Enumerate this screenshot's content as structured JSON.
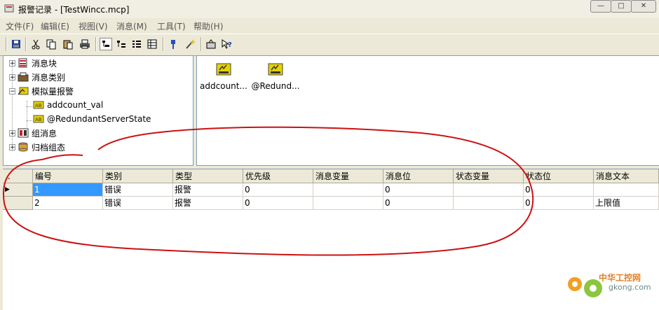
{
  "window": {
    "title": "报警记录 - [TestWincc.mcp]"
  },
  "window_buttons": {
    "minimize": "—",
    "maximize": "□",
    "close": "✕"
  },
  "menubar": [
    {
      "label": "文件(F)"
    },
    {
      "label": "编辑(E)"
    },
    {
      "label": "视图(V)"
    },
    {
      "label": "消息(M)"
    },
    {
      "label": "工具(T)"
    },
    {
      "label": "帮助(H)"
    }
  ],
  "toolbar": {
    "icons": [
      "save-icon",
      "cut-icon",
      "copy-icon",
      "paste-icon",
      "print-icon",
      "view-icon-1",
      "view-icon-2",
      "view-icon-3",
      "view-icon-4",
      "properties-icon",
      "wizard-icon",
      "export-icon",
      "help-icon"
    ]
  },
  "tree": {
    "items": [
      {
        "label": "消息块",
        "expander": "+"
      },
      {
        "label": "消息类别",
        "expander": "+"
      },
      {
        "label": "模拟量报警",
        "expander": "−"
      },
      {
        "label": "addcount_val"
      },
      {
        "label": "@RedundantServerState"
      },
      {
        "label": "组消息",
        "expander": "+"
      },
      {
        "label": "归档组态",
        "expander": "+"
      }
    ]
  },
  "icon_pane": {
    "items": [
      {
        "label": "addcount..."
      },
      {
        "label": "@Redund..."
      }
    ]
  },
  "grid": {
    "corner": "..",
    "columns": [
      "编号",
      "类别",
      "类型",
      "优先级",
      "消息变量",
      "消息位",
      "状态变量",
      "状态位",
      "消息文本"
    ],
    "rows": [
      [
        "1",
        "错误",
        "报警",
        "0",
        "",
        "0",
        "",
        "0",
        ""
      ],
      [
        "2",
        "错误",
        "报警",
        "0",
        "",
        "0",
        "",
        "0",
        "上限值"
      ]
    ],
    "row_pointer": "▶"
  },
  "watermark": {
    "line1": "中华工控网",
    "line2": "gkong.com"
  },
  "colors": {
    "selection": "#3399ff",
    "annotation": "#cc1111",
    "background": "#ece9d8"
  }
}
